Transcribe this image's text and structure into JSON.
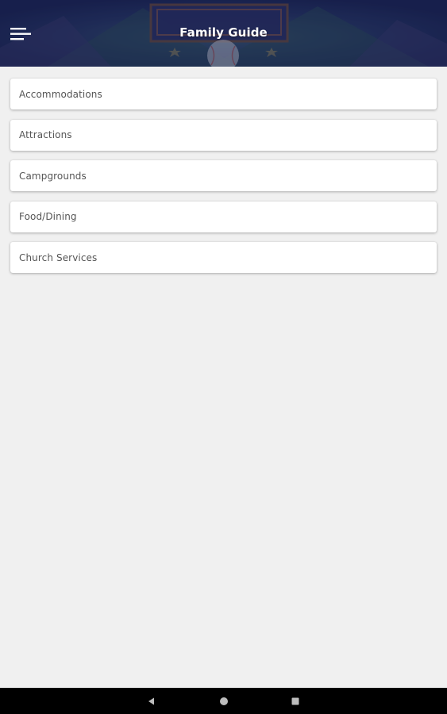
{
  "header": {
    "title": "Family Guide",
    "background_color": "#243268",
    "menu_icon": "menu-icon"
  },
  "list": {
    "items": [
      {
        "label": "Accommodations"
      },
      {
        "label": "Attractions"
      },
      {
        "label": "Campgrounds"
      },
      {
        "label": "Food/Dining"
      },
      {
        "label": "Church Services"
      }
    ]
  },
  "nav_bar": {
    "back_icon": "back-triangle-icon",
    "home_icon": "home-circle-icon",
    "recents_icon": "recents-square-icon"
  },
  "colors": {
    "page_background": "#f0f0f0",
    "card_background": "#ffffff",
    "item_text": "#555555",
    "title_text": "#ffffff"
  }
}
